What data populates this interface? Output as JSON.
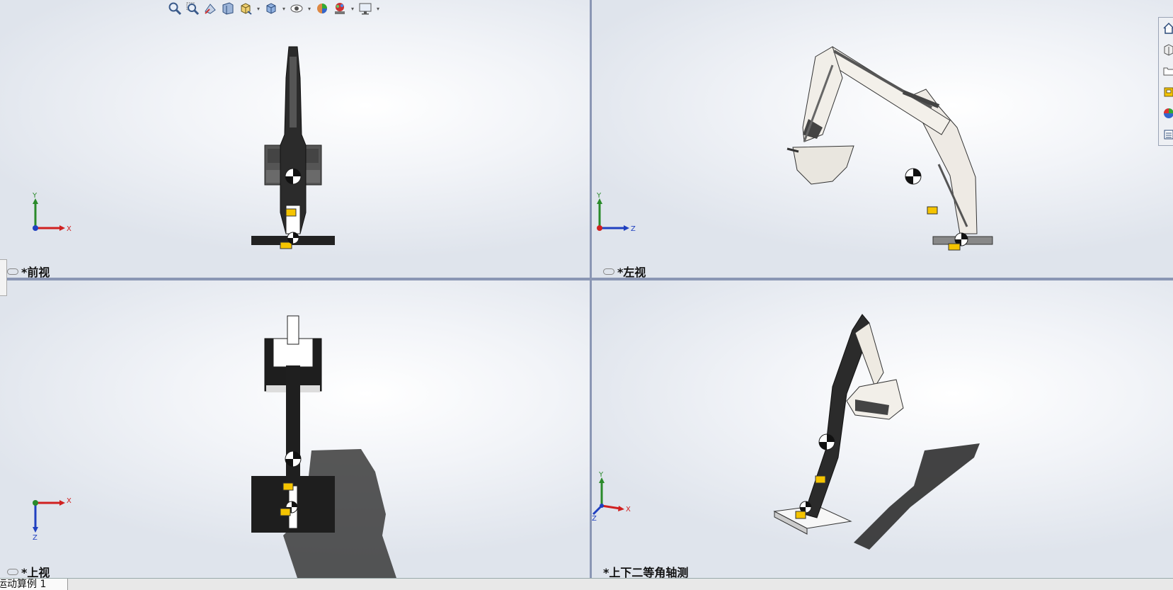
{
  "views": {
    "front": {
      "label": "*前视"
    },
    "left": {
      "label": "*左视"
    },
    "top": {
      "label": "*上视"
    },
    "iso": {
      "label": "*上下二等角轴测"
    }
  },
  "axes": {
    "x": "X",
    "y": "Y",
    "z": "Z"
  },
  "toolbar": {
    "icons": [
      "zoom-to-fit-icon",
      "zoom-area-icon",
      "previous-view-icon",
      "section-view-icon",
      "view-orientation-icon",
      "display-style-icon",
      "hide-show-icon",
      "edit-appearance-icon",
      "apply-scene-icon",
      "view-settings-icon"
    ]
  },
  "task_pane": {
    "icons": [
      "home-icon",
      "design-library-icon",
      "file-explorer-icon",
      "view-palette-icon",
      "appearances-icon",
      "custom-properties-icon"
    ]
  },
  "bottom": {
    "motion_study_tab": "运动算例 1"
  },
  "colors": {
    "split": "#8a96b4",
    "model_dark": "#2b2b2b",
    "model_light": "#f2efe9",
    "com_marker_yellow": "#f5c400"
  }
}
